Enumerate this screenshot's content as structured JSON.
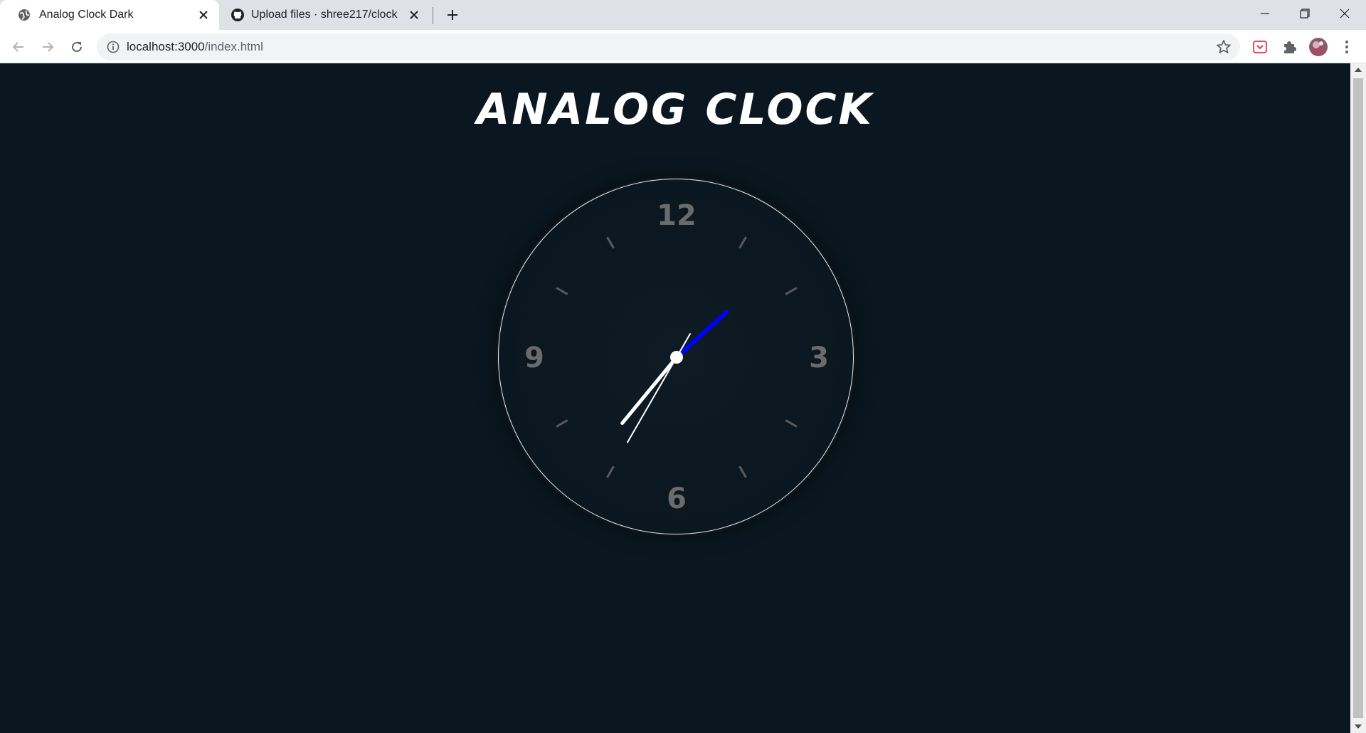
{
  "browser": {
    "tabs": [
      {
        "title": "Analog Clock Dark",
        "icon": "globe-icon",
        "active": true
      },
      {
        "title": "Upload files · shree217/clock",
        "icon": "github-icon",
        "active": false
      }
    ],
    "address": {
      "host": "localhost:3000",
      "path": "/index.html"
    }
  },
  "page": {
    "heading": "ANALOG CLOCK",
    "background_color": "#0a1720",
    "clock": {
      "numerals": [
        "12",
        "3",
        "6",
        "9"
      ],
      "numeral_color": "#6b6b6b",
      "time": {
        "hours": 1,
        "minutes": 36,
        "seconds": 35
      },
      "hand_colors": {
        "hour": "#0000ff",
        "minute": "#ffffff",
        "second": "#ffffff"
      }
    }
  }
}
